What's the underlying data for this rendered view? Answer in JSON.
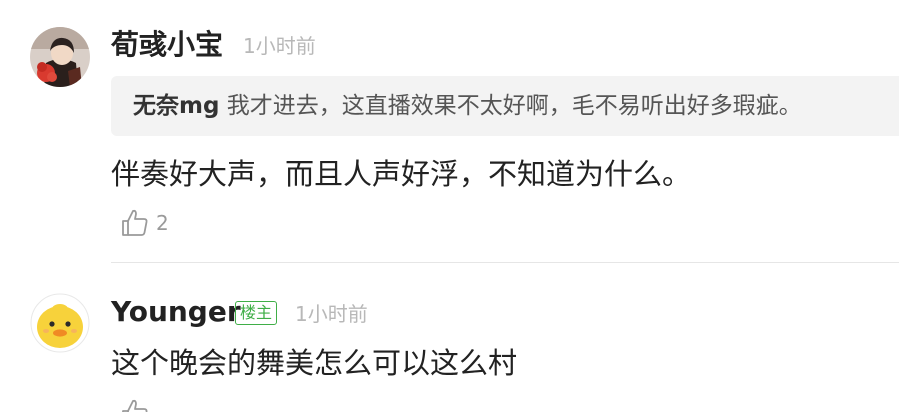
{
  "comments": [
    {
      "username": "荀彧小宝",
      "time": "1小时前",
      "avatar_icon": "anime-character-avatar",
      "quote": {
        "author": "无奈mg",
        "text": "我才进去，这直播效果不太好啊，毛不易听出好多瑕疵。"
      },
      "text": "伴奏好大声，而且人声好浮，不知道为什么。",
      "likes": "2"
    },
    {
      "username": "Younger",
      "badge": "楼主",
      "time": "1小时前",
      "avatar_icon": "yellow-duck-avatar",
      "text": "这个晚会的舞美怎么可以这么村"
    }
  ]
}
